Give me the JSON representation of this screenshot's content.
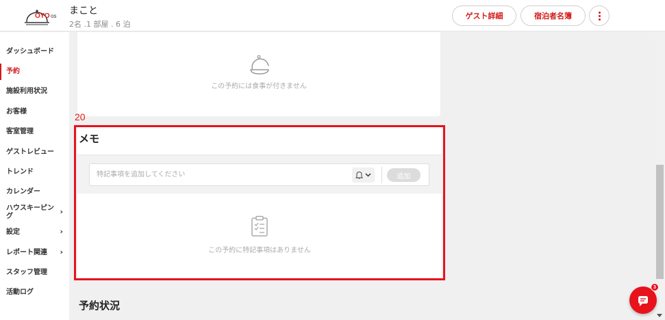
{
  "header": {
    "logo_text": "OYO",
    "logo_suffix": "os",
    "guest_name": "まこと",
    "guest_meta": "2名 .1 部屋 . 6 泊",
    "guest_detail_label": "ゲスト詳細",
    "registry_label": "宿泊者名簿"
  },
  "sidebar": {
    "items": [
      {
        "label": "ダッシュボード"
      },
      {
        "label": "予約"
      },
      {
        "label": "施設利用状況"
      },
      {
        "label": "お客様"
      },
      {
        "label": "客室管理"
      },
      {
        "label": "ゲストレビュー"
      },
      {
        "label": "トレンド"
      },
      {
        "label": "カレンダー"
      },
      {
        "label": "ハウスキーピング"
      },
      {
        "label": "設定"
      },
      {
        "label": "レポート関連"
      },
      {
        "label": "スタッフ管理"
      },
      {
        "label": "活動ログ"
      }
    ],
    "active_item": "予約"
  },
  "meals": {
    "empty_text": "この予約には食事が付きません"
  },
  "annotation_number": "20",
  "memo": {
    "title": "メモ",
    "input_value": "",
    "input_placeholder": "特記事項を追加してください",
    "add_label": "追加",
    "empty_text": "この予約に特記事項はありません"
  },
  "booking_status": {
    "title": "予約状況"
  },
  "chat": {
    "badge_count": "3"
  },
  "colors": {
    "brand_red": "#d31a1a",
    "annotation_red": "#e8121c"
  }
}
